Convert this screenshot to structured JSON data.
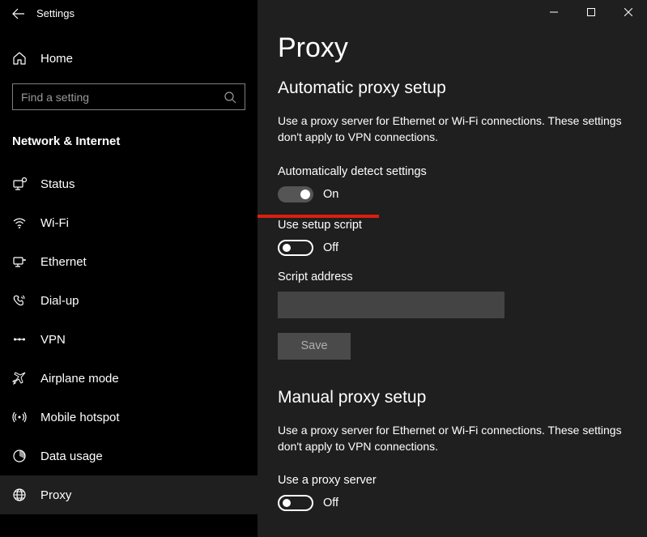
{
  "app_title": "Settings",
  "window": {
    "min": "",
    "max": "",
    "close": ""
  },
  "home_label": "Home",
  "search_placeholder": "Find a setting",
  "section_title": "Network & Internet",
  "nav": [
    {
      "id": "status",
      "label": "Status"
    },
    {
      "id": "wifi",
      "label": "Wi-Fi"
    },
    {
      "id": "ethernet",
      "label": "Ethernet"
    },
    {
      "id": "dialup",
      "label": "Dial-up"
    },
    {
      "id": "vpn",
      "label": "VPN"
    },
    {
      "id": "airplane",
      "label": "Airplane mode"
    },
    {
      "id": "hotspot",
      "label": "Mobile hotspot"
    },
    {
      "id": "datausage",
      "label": "Data usage"
    },
    {
      "id": "proxy",
      "label": "Proxy"
    }
  ],
  "page": {
    "title": "Proxy",
    "auto_header": "Automatic proxy setup",
    "auto_desc": "Use a proxy server for Ethernet or Wi-Fi connections. These settings don't apply to VPN connections.",
    "auto_detect_label": "Automatically detect settings",
    "auto_detect_state": "On",
    "setup_script_label": "Use setup script",
    "setup_script_state": "Off",
    "script_addr_label": "Script address",
    "script_addr_value": "",
    "save_label": "Save",
    "manual_header": "Manual proxy setup",
    "manual_desc": "Use a proxy server for Ethernet or Wi-Fi connections. These settings don't apply to VPN connections.",
    "use_proxy_label": "Use a proxy server",
    "use_proxy_state": "Off"
  }
}
